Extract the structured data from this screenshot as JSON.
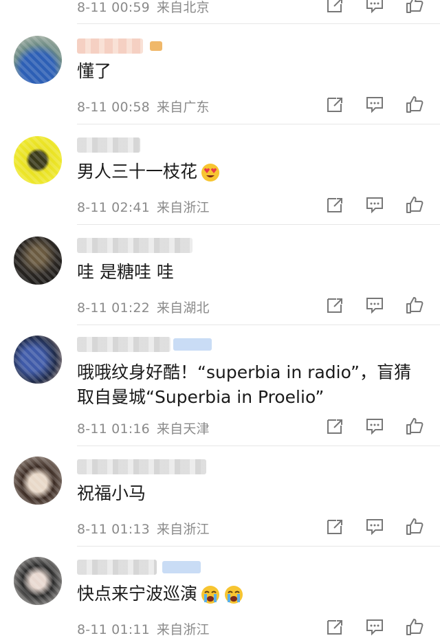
{
  "comments": [
    {
      "text": "",
      "date": "8-11 00:59",
      "location": "来自北京"
    },
    {
      "text": "懂了",
      "date": "8-11 00:58",
      "location": "来自广东"
    },
    {
      "text": "男人三十一枝花",
      "emoji": "heart-eyes-emoji",
      "date": "8-11 02:41",
      "location": "来自浙江"
    },
    {
      "text": "哇 是糖哇 哇",
      "date": "8-11 01:22",
      "location": "来自湖北"
    },
    {
      "text_line1": "哦哦纹身好酷！“superbia in radio”，盲猜",
      "text_line2": "取自曼城“Superbia in Proelio”",
      "date": "8-11 01:16",
      "location": "来自天津"
    },
    {
      "text": "祝福小马",
      "date": "8-11 01:13",
      "location": "来自浙江"
    },
    {
      "text": "快点来宁波巡演",
      "emoji": "crying-emoji",
      "date": "8-11 01:11",
      "location": "来自浙江"
    }
  ],
  "icons": {
    "share": "share-icon",
    "comment": "comment-icon",
    "like": "thumbs-up-icon"
  },
  "colors": {
    "meta": "#8a8a8a",
    "divider": "#e6e6e6",
    "icon": "#777777"
  }
}
